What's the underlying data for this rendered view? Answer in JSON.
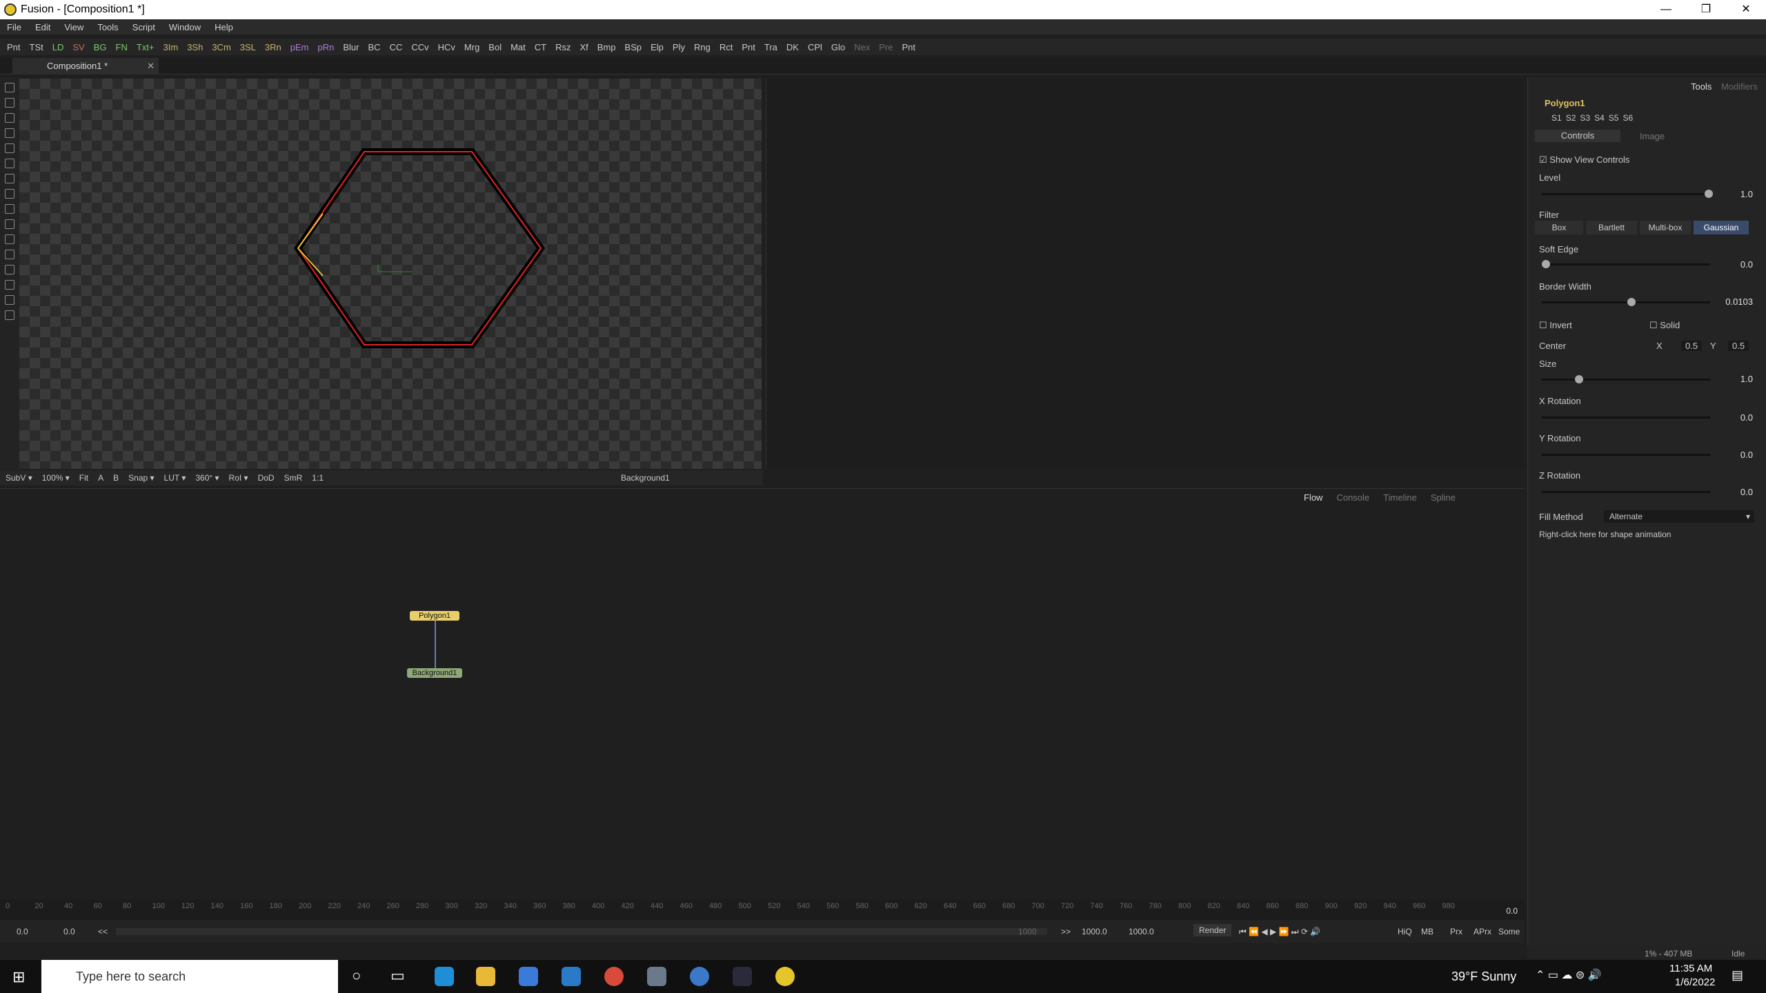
{
  "window": {
    "title": "Fusion - [Composition1 *]",
    "min": "—",
    "max": "❐",
    "close": "✕"
  },
  "menu": [
    "File",
    "Edit",
    "View",
    "Tools",
    "Script",
    "Window",
    "Help"
  ],
  "toolbar": {
    "items": [
      {
        "label": "Pnt",
        "c": ""
      },
      {
        "label": "TSt",
        "c": ""
      },
      {
        "label": "LD",
        "c": "g"
      },
      {
        "label": "SV",
        "c": "r"
      },
      {
        "label": "BG",
        "c": "g"
      },
      {
        "label": "FN",
        "c": "g"
      },
      {
        "label": "Txt+",
        "c": "g"
      },
      {
        "label": "3Im",
        "c": "y"
      },
      {
        "label": "3Sh",
        "c": "y"
      },
      {
        "label": "3Cm",
        "c": "y"
      },
      {
        "label": "3SL",
        "c": "y"
      },
      {
        "label": "3Rn",
        "c": "y"
      },
      {
        "label": "pEm",
        "c": "p"
      },
      {
        "label": "pRn",
        "c": "p"
      },
      {
        "label": "Blur",
        "c": ""
      },
      {
        "label": "BC",
        "c": ""
      },
      {
        "label": "CC",
        "c": ""
      },
      {
        "label": "CCv",
        "c": ""
      },
      {
        "label": "HCv",
        "c": ""
      },
      {
        "label": "Mrg",
        "c": ""
      },
      {
        "label": "Bol",
        "c": ""
      },
      {
        "label": "Mat",
        "c": ""
      },
      {
        "label": "CT",
        "c": ""
      },
      {
        "label": "Rsz",
        "c": ""
      },
      {
        "label": "Xf",
        "c": ""
      },
      {
        "label": "Bmp",
        "c": ""
      },
      {
        "label": "BSp",
        "c": ""
      },
      {
        "label": "Elp",
        "c": ""
      },
      {
        "label": "Ply",
        "c": ""
      },
      {
        "label": "Rng",
        "c": ""
      },
      {
        "label": "Rct",
        "c": ""
      },
      {
        "label": "Pnt",
        "c": ""
      },
      {
        "label": "Tra",
        "c": ""
      },
      {
        "label": "DK",
        "c": ""
      },
      {
        "label": "CPl",
        "c": ""
      },
      {
        "label": "Glo",
        "c": ""
      },
      {
        "label": "Nex",
        "c": "dim"
      },
      {
        "label": "Pre",
        "c": "dim"
      },
      {
        "label": "Pnt",
        "c": ""
      }
    ]
  },
  "doc_tab": {
    "label": "Composition1 *",
    "close": "✕"
  },
  "viewer_bar": {
    "items": [
      "SubV ▾",
      "100% ▾",
      "Fit",
      "A",
      "B",
      "Snap ▾",
      "LUT ▾",
      "360° ▾",
      "RoI ▾",
      "DoD",
      "SmR",
      "1:1"
    ],
    "node": "Background1"
  },
  "flow_tabs": [
    "Flow",
    "Console",
    "Timeline",
    "Spline"
  ],
  "nodes": {
    "polygon": "Polygon1",
    "background": "Background1"
  },
  "timeline": {
    "ticks": [
      "0",
      "20",
      "40",
      "60",
      "80",
      "100",
      "120",
      "140",
      "160",
      "180",
      "200",
      "220",
      "240",
      "260",
      "280",
      "300",
      "320",
      "340",
      "360",
      "380",
      "400",
      "420",
      "440",
      "460",
      "480",
      "500",
      "520",
      "540",
      "560",
      "580",
      "600",
      "620",
      "640",
      "660",
      "680",
      "700",
      "720",
      "740",
      "760",
      "780",
      "800",
      "820",
      "840",
      "860",
      "880",
      "900",
      "920",
      "940",
      "960",
      "980"
    ],
    "current": "0.0",
    "start": "0.0",
    "render_start": "0.0",
    "end_range": "1000",
    "render_end": "1000.0",
    "end": "1000.0",
    "render_label": "Render",
    "arrows": "<<",
    "arrows2": ">>",
    "quality": [
      "HiQ",
      "MB",
      "Prx",
      "APrx",
      "Some"
    ]
  },
  "inspector": {
    "tabs": {
      "tools": "Tools",
      "modifiers": "Modifiers"
    },
    "node_name": "Polygon1",
    "slots": [
      "S1",
      "S2",
      "S3",
      "S4",
      "S5",
      "S6"
    ],
    "subtabs": {
      "controls": "Controls",
      "image": "Image"
    },
    "show_view_controls": "Show View Controls",
    "level": {
      "label": "Level",
      "value": "1.0",
      "fraction": 1.0
    },
    "filter": {
      "label": "Filter",
      "options": [
        "Box",
        "Bartlett",
        "Multi-box",
        "Gaussian"
      ],
      "selected": "Gaussian"
    },
    "soft_edge": {
      "label": "Soft Edge",
      "value": "0.0",
      "fraction": 0.0
    },
    "border_width": {
      "label": "Border Width",
      "value": "0.0103",
      "fraction": 0.6
    },
    "invert": "Invert",
    "solid": "Solid",
    "center": {
      "label": "Center",
      "x_label": "X",
      "x": "0.5",
      "y_label": "Y",
      "y": "0.5"
    },
    "size": {
      "label": "Size",
      "value": "1.0",
      "fraction": 0.2
    },
    "x_rotation": {
      "label": "X Rotation",
      "value": "0.0"
    },
    "y_rotation": {
      "label": "Y Rotation",
      "value": "0.0"
    },
    "z_rotation": {
      "label": "Z Rotation",
      "value": "0.0"
    },
    "fill_method": {
      "label": "Fill Method",
      "value": "Alternate"
    },
    "shape_hint": "Right-click here for shape animation"
  },
  "status": {
    "memory": "1% - 407 MB",
    "state": "Idle"
  },
  "taskbar": {
    "search_placeholder": "Type here to search",
    "weather": "39°F  Sunny",
    "time": "11:35 AM",
    "date": "1/6/2022"
  }
}
